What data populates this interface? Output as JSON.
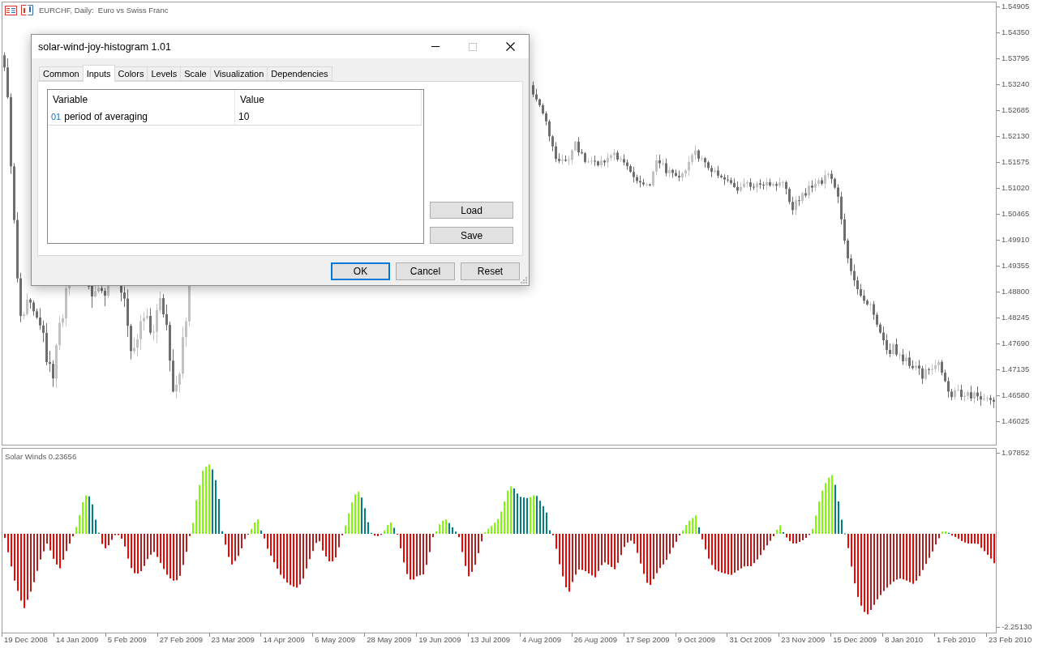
{
  "chart": {
    "title": "EURCHF, Daily:  Euro vs Swiss Franc",
    "price_axis": [
      "1.54905",
      "1.54350",
      "1.53795",
      "1.53240",
      "1.52685",
      "1.52130",
      "1.51575",
      "1.51020",
      "1.50465",
      "1.49910",
      "1.49355",
      "1.48800",
      "1.48245",
      "1.47690",
      "1.47135",
      "1.46580",
      "1.46025"
    ]
  },
  "indicator": {
    "label": "Solar Winds 0.23656",
    "scale": [
      "1.97852",
      "-2.25130"
    ]
  },
  "time_axis": [
    "19 Dec 2008",
    "14 Jan 2009",
    "5 Feb 2009",
    "27 Feb 2009",
    "23 Mar 2009",
    "14 Apr 2009",
    "6 May 2009",
    "28 May 2009",
    "19 Jun 2009",
    "13 Jul 2009",
    "4 Aug 2009",
    "26 Aug 2009",
    "17 Sep 2009",
    "9 Oct 2009",
    "31 Oct 2009",
    "23 Nov 2009",
    "15 Dec 2009",
    "8 Jan 2010",
    "1 Feb 2010",
    "23 Feb 2010"
  ],
  "dialog": {
    "title": "solar-wind-joy-histogram 1.01",
    "window_buttons": [
      {
        "kind": "minimize",
        "disabled": false
      },
      {
        "kind": "maximize",
        "disabled": true
      },
      {
        "kind": "close",
        "disabled": false
      }
    ],
    "tabs": [
      {
        "label": "Common",
        "selected": false
      },
      {
        "label": "Inputs",
        "selected": true
      },
      {
        "label": "Colors",
        "selected": false
      },
      {
        "label": "Levels",
        "selected": false
      },
      {
        "label": "Scale",
        "selected": false
      },
      {
        "label": "Visualization",
        "selected": false
      },
      {
        "label": "Dependencies",
        "selected": false
      }
    ],
    "table": {
      "columns": [
        "Variable",
        "Value"
      ],
      "rows": [
        {
          "type": "01",
          "variable": "period of averaging",
          "value": "10"
        }
      ]
    },
    "side_buttons": [
      "Load",
      "Save"
    ],
    "buttons": [
      {
        "label": "OK",
        "default": true
      },
      {
        "label": "Cancel",
        "default": false
      },
      {
        "label": "Reset",
        "default": false
      }
    ]
  }
}
